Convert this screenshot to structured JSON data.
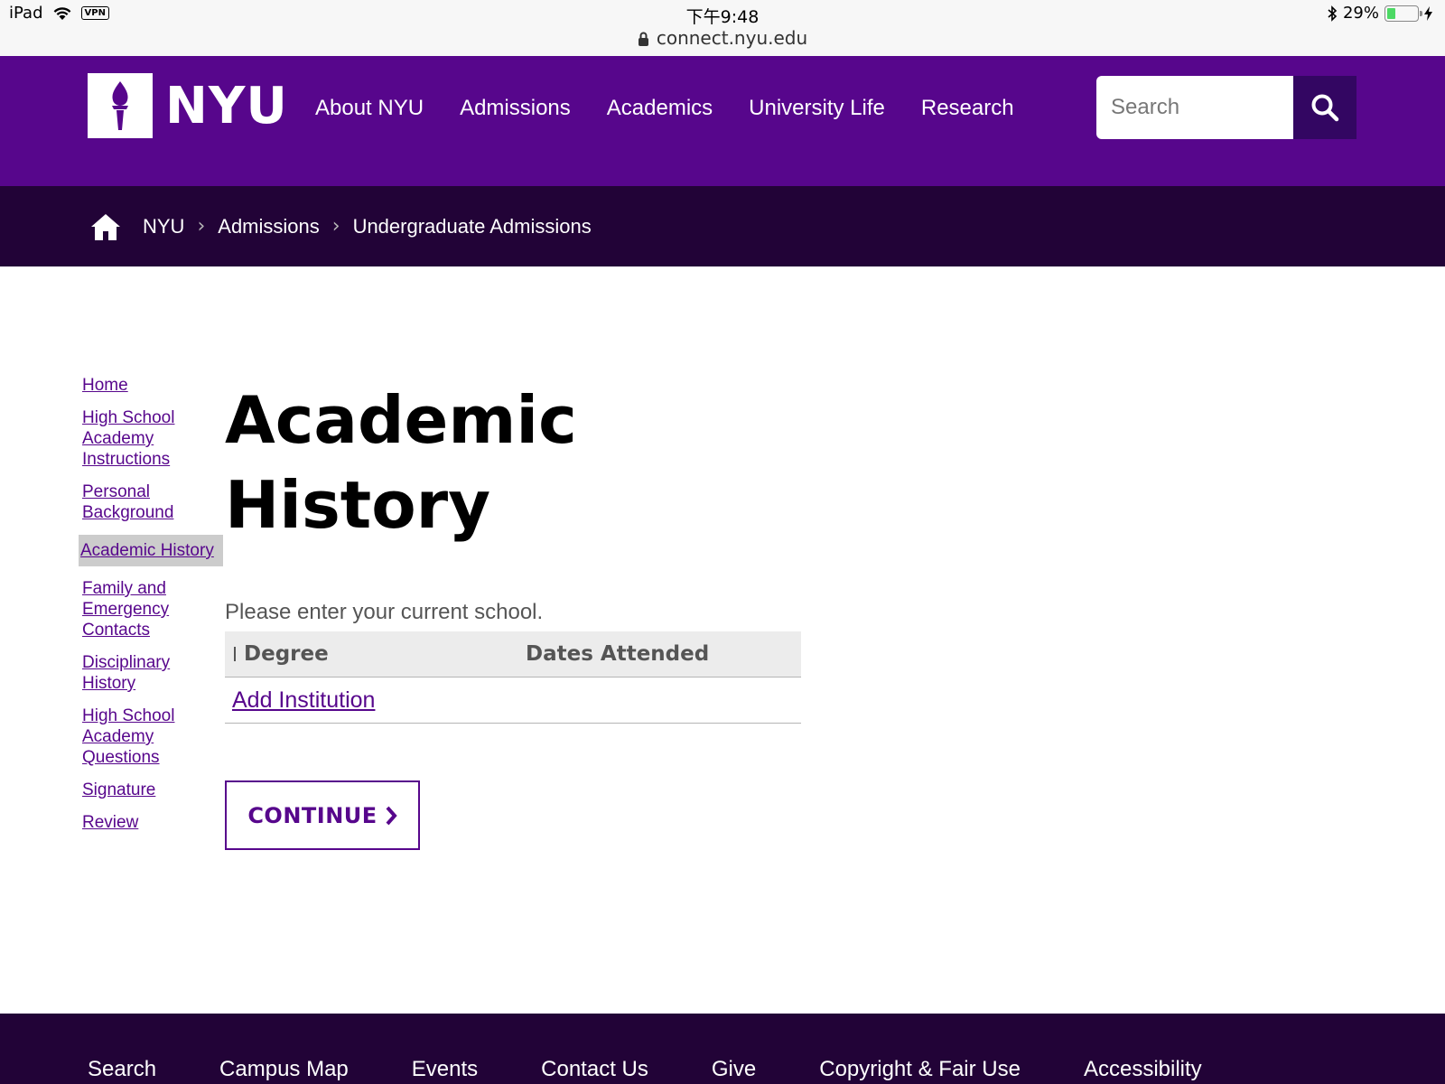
{
  "status_bar": {
    "device": "iPad",
    "vpn_label": "VPN",
    "time": "下午9:48",
    "url": "connect.nyu.edu",
    "battery": "29%",
    "battery_level": 0.29
  },
  "header": {
    "logo_text": "NYU",
    "nav": [
      "About NYU",
      "Admissions",
      "Academics",
      "University Life",
      "Research"
    ],
    "search_placeholder": "Search"
  },
  "breadcrumb": [
    "NYU",
    "Admissions",
    "Undergraduate Admissions"
  ],
  "sidebar": {
    "items": [
      {
        "label": "Home",
        "active": false
      },
      {
        "label": "High School Academy Instructions",
        "active": false
      },
      {
        "label": "Personal Background",
        "active": false
      },
      {
        "label": "Academic History",
        "active": true
      },
      {
        "label": "Family and Emergency Contacts",
        "active": false
      },
      {
        "label": "Disciplinary History",
        "active": false
      },
      {
        "label": "High School Academy Questions",
        "active": false
      },
      {
        "label": "Signature",
        "active": false
      },
      {
        "label": "Review",
        "active": false
      }
    ]
  },
  "main": {
    "title": "Academic History",
    "prompt": "Please enter your current school.",
    "table": {
      "columns": [
        "Degree",
        "Dates Attended"
      ],
      "add_link": "Add Institution"
    },
    "continue_label": "CONTINUE"
  },
  "footer": {
    "links": [
      "Search",
      "Campus Map",
      "Events",
      "Contact Us",
      "Give",
      "Copyright & Fair Use",
      "Accessibility"
    ]
  },
  "colors": {
    "brand_purple": "#57068c",
    "dark_purple": "#220337",
    "search_button": "#330662"
  }
}
